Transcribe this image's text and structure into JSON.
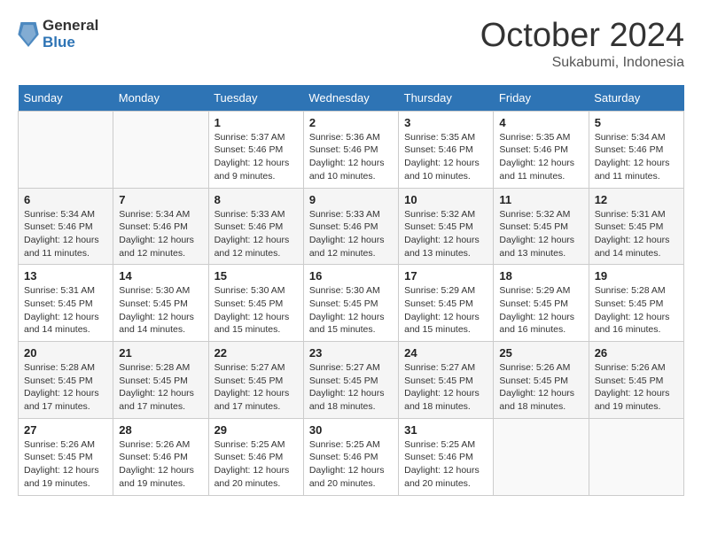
{
  "header": {
    "logo_general": "General",
    "logo_blue": "Blue",
    "month": "October 2024",
    "location": "Sukabumi, Indonesia"
  },
  "days_of_week": [
    "Sunday",
    "Monday",
    "Tuesday",
    "Wednesday",
    "Thursday",
    "Friday",
    "Saturday"
  ],
  "weeks": [
    [
      {
        "day": "",
        "info": ""
      },
      {
        "day": "",
        "info": ""
      },
      {
        "day": "1",
        "info": "Sunrise: 5:37 AM\nSunset: 5:46 PM\nDaylight: 12 hours and 9 minutes."
      },
      {
        "day": "2",
        "info": "Sunrise: 5:36 AM\nSunset: 5:46 PM\nDaylight: 12 hours and 10 minutes."
      },
      {
        "day": "3",
        "info": "Sunrise: 5:35 AM\nSunset: 5:46 PM\nDaylight: 12 hours and 10 minutes."
      },
      {
        "day": "4",
        "info": "Sunrise: 5:35 AM\nSunset: 5:46 PM\nDaylight: 12 hours and 11 minutes."
      },
      {
        "day": "5",
        "info": "Sunrise: 5:34 AM\nSunset: 5:46 PM\nDaylight: 12 hours and 11 minutes."
      }
    ],
    [
      {
        "day": "6",
        "info": "Sunrise: 5:34 AM\nSunset: 5:46 PM\nDaylight: 12 hours and 11 minutes."
      },
      {
        "day": "7",
        "info": "Sunrise: 5:34 AM\nSunset: 5:46 PM\nDaylight: 12 hours and 12 minutes."
      },
      {
        "day": "8",
        "info": "Sunrise: 5:33 AM\nSunset: 5:46 PM\nDaylight: 12 hours and 12 minutes."
      },
      {
        "day": "9",
        "info": "Sunrise: 5:33 AM\nSunset: 5:46 PM\nDaylight: 12 hours and 12 minutes."
      },
      {
        "day": "10",
        "info": "Sunrise: 5:32 AM\nSunset: 5:45 PM\nDaylight: 12 hours and 13 minutes."
      },
      {
        "day": "11",
        "info": "Sunrise: 5:32 AM\nSunset: 5:45 PM\nDaylight: 12 hours and 13 minutes."
      },
      {
        "day": "12",
        "info": "Sunrise: 5:31 AM\nSunset: 5:45 PM\nDaylight: 12 hours and 14 minutes."
      }
    ],
    [
      {
        "day": "13",
        "info": "Sunrise: 5:31 AM\nSunset: 5:45 PM\nDaylight: 12 hours and 14 minutes."
      },
      {
        "day": "14",
        "info": "Sunrise: 5:30 AM\nSunset: 5:45 PM\nDaylight: 12 hours and 14 minutes."
      },
      {
        "day": "15",
        "info": "Sunrise: 5:30 AM\nSunset: 5:45 PM\nDaylight: 12 hours and 15 minutes."
      },
      {
        "day": "16",
        "info": "Sunrise: 5:30 AM\nSunset: 5:45 PM\nDaylight: 12 hours and 15 minutes."
      },
      {
        "day": "17",
        "info": "Sunrise: 5:29 AM\nSunset: 5:45 PM\nDaylight: 12 hours and 15 minutes."
      },
      {
        "day": "18",
        "info": "Sunrise: 5:29 AM\nSunset: 5:45 PM\nDaylight: 12 hours and 16 minutes."
      },
      {
        "day": "19",
        "info": "Sunrise: 5:28 AM\nSunset: 5:45 PM\nDaylight: 12 hours and 16 minutes."
      }
    ],
    [
      {
        "day": "20",
        "info": "Sunrise: 5:28 AM\nSunset: 5:45 PM\nDaylight: 12 hours and 17 minutes."
      },
      {
        "day": "21",
        "info": "Sunrise: 5:28 AM\nSunset: 5:45 PM\nDaylight: 12 hours and 17 minutes."
      },
      {
        "day": "22",
        "info": "Sunrise: 5:27 AM\nSunset: 5:45 PM\nDaylight: 12 hours and 17 minutes."
      },
      {
        "day": "23",
        "info": "Sunrise: 5:27 AM\nSunset: 5:45 PM\nDaylight: 12 hours and 18 minutes."
      },
      {
        "day": "24",
        "info": "Sunrise: 5:27 AM\nSunset: 5:45 PM\nDaylight: 12 hours and 18 minutes."
      },
      {
        "day": "25",
        "info": "Sunrise: 5:26 AM\nSunset: 5:45 PM\nDaylight: 12 hours and 18 minutes."
      },
      {
        "day": "26",
        "info": "Sunrise: 5:26 AM\nSunset: 5:45 PM\nDaylight: 12 hours and 19 minutes."
      }
    ],
    [
      {
        "day": "27",
        "info": "Sunrise: 5:26 AM\nSunset: 5:45 PM\nDaylight: 12 hours and 19 minutes."
      },
      {
        "day": "28",
        "info": "Sunrise: 5:26 AM\nSunset: 5:46 PM\nDaylight: 12 hours and 19 minutes."
      },
      {
        "day": "29",
        "info": "Sunrise: 5:25 AM\nSunset: 5:46 PM\nDaylight: 12 hours and 20 minutes."
      },
      {
        "day": "30",
        "info": "Sunrise: 5:25 AM\nSunset: 5:46 PM\nDaylight: 12 hours and 20 minutes."
      },
      {
        "day": "31",
        "info": "Sunrise: 5:25 AM\nSunset: 5:46 PM\nDaylight: 12 hours and 20 minutes."
      },
      {
        "day": "",
        "info": ""
      },
      {
        "day": "",
        "info": ""
      }
    ]
  ]
}
